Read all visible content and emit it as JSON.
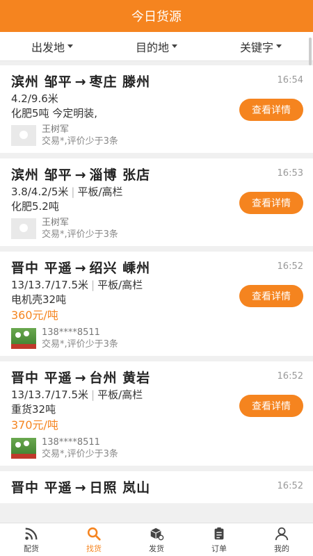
{
  "header": {
    "title": "今日货源"
  },
  "filters": [
    {
      "label": "出发地"
    },
    {
      "label": "目的地"
    },
    {
      "label": "关键字"
    }
  ],
  "cards": [
    {
      "from": "滨州 邹平",
      "to": "枣庄 滕州",
      "time": "16:54",
      "spec": "4.2/9.6米",
      "vehicle": "",
      "goods": "化肥5吨 今定明装,",
      "price": "",
      "user_name": "王树军",
      "user_meta": "交易*,评价少于3条",
      "avatar": "default",
      "button": "查看详情"
    },
    {
      "from": "滨州 邹平",
      "to": "淄博 张店",
      "time": "16:53",
      "spec": "3.8/4.2/5米",
      "vehicle": "平板/高栏",
      "goods": "化肥5.2吨",
      "price": "",
      "user_name": "王树军",
      "user_meta": "交易*,评价少于3条",
      "avatar": "default",
      "button": "查看详情"
    },
    {
      "from": "晋中 平遥",
      "to": "绍兴 嵊州",
      "time": "16:52",
      "spec": "13/13.7/17.5米",
      "vehicle": "平板/高栏",
      "goods": "电机壳32吨",
      "price": "360元/吨",
      "user_name": "138****8511",
      "user_meta": "交易*,评价少于3条",
      "avatar": "photo",
      "button": "查看详情"
    },
    {
      "from": "晋中 平遥",
      "to": "台州 黄岩",
      "time": "16:52",
      "spec": "13/13.7/17.5米",
      "vehicle": "平板/高栏",
      "goods": "重货32吨",
      "price": "370元/吨",
      "user_name": "138****8511",
      "user_meta": "交易*,评价少于3条",
      "avatar": "photo",
      "button": "查看详情"
    },
    {
      "from": "晋中 平遥",
      "to": "日照 岚山",
      "time": "16:52",
      "spec": "",
      "vehicle": "",
      "goods": "",
      "price": "",
      "user_name": "",
      "user_meta": "",
      "avatar": "none",
      "button": ""
    }
  ],
  "arrow": "→",
  "separator": "|",
  "tabs": [
    {
      "label": "配货",
      "icon": "rss-icon",
      "active": false
    },
    {
      "label": "找货",
      "icon": "search-icon",
      "active": true
    },
    {
      "label": "发货",
      "icon": "box-icon",
      "active": false
    },
    {
      "label": "订单",
      "icon": "clipboard-icon",
      "active": false
    },
    {
      "label": "我的",
      "icon": "user-icon",
      "active": false
    }
  ],
  "colors": {
    "accent": "#f5841f",
    "background": "#f0f0f0"
  }
}
